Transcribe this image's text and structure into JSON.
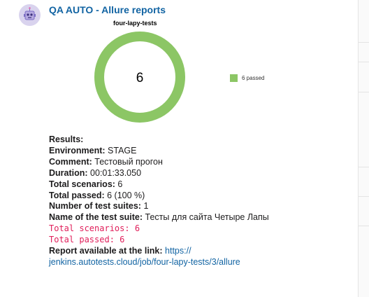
{
  "message": {
    "sender": "QA AUTO - Allure reports"
  },
  "chart_data": {
    "type": "pie",
    "title": "four-lapy-tests",
    "center_label": "6",
    "categories": [
      "6 passed"
    ],
    "values": [
      6
    ],
    "colors": [
      "#8cc665"
    ],
    "legend": "right"
  },
  "report": {
    "results_label": "Results:",
    "env_label": "Environment:",
    "env_value": " STAGE",
    "comment_label": "Comment:",
    "comment_value": " Тестовый прогон",
    "duration_label": "Duration:",
    "duration_value": " 00:01:33.050",
    "scenarios_label": "Total scenarios:",
    "scenarios_value": " 6",
    "passed_label": "Total passed:",
    "passed_value": " 6 (100 %)",
    "suites_label": "Number of test suites:",
    "suites_value": " 1",
    "suite_name_label": "Name of the test suite:",
    "suite_name_value": " Тесты для сайта Четыре Лапы",
    "code_scenarios": "Total scenarios: 6",
    "code_passed": "Total passed: 6",
    "link_label": "Report available at the link:",
    "link_text": "https:// jenkins.autotests.cloud/job/four-lapy-tests/3/allure"
  }
}
